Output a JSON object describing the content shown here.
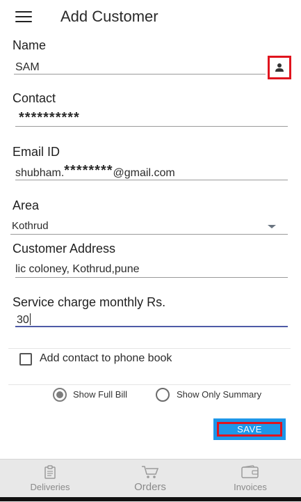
{
  "appbar": {
    "title": "Add Customer",
    "menu_icon": "hamburger-menu-icon"
  },
  "form": {
    "name": {
      "label": "Name",
      "value": "SAM",
      "icon": "contact-picker-icon"
    },
    "contact": {
      "label": "Contact",
      "value": "**********"
    },
    "email": {
      "label": "Email ID",
      "value_prefix": "shubham.",
      "value_masked": "********",
      "value_suffix": "@gmail.com"
    },
    "area": {
      "label": "Area",
      "value": "Kothrud",
      "icon": "dropdown-arrow-icon"
    },
    "address": {
      "label": "Customer Address",
      "value": "lic coloney, Kothrud,pune"
    },
    "service_charge": {
      "label": "Service charge monthly Rs.",
      "value": "30"
    },
    "add_to_phonebook": {
      "label": "Add contact to phone book",
      "checked": false
    },
    "bill_options": [
      {
        "label": "Show Full Bill",
        "selected": true
      },
      {
        "label": "Show Only Summary",
        "selected": false
      }
    ],
    "save_label": "SAVE"
  },
  "bottom_nav": [
    {
      "label": "Deliveries",
      "icon": "clipboard-icon"
    },
    {
      "label": "Orders",
      "icon": "cart-icon"
    },
    {
      "label": "Invoices",
      "icon": "wallet-icon"
    }
  ],
  "colors": {
    "accent": "#1e97e9",
    "highlight": "#e0141e"
  }
}
